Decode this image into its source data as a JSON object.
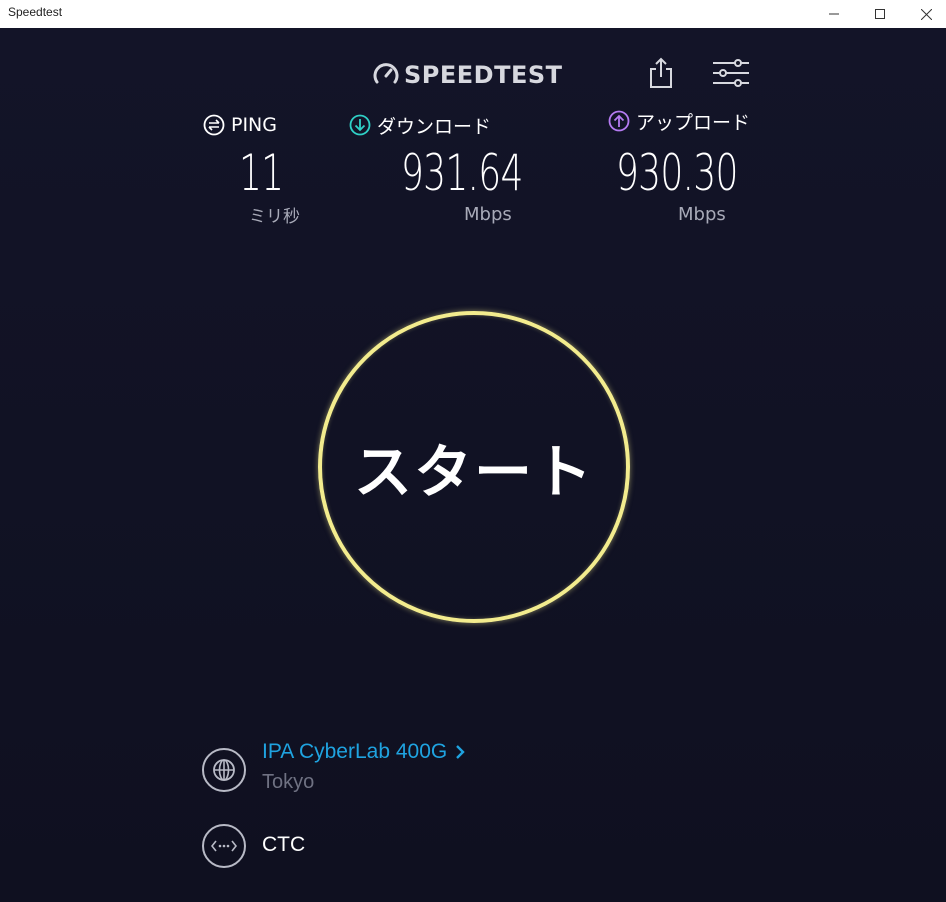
{
  "window": {
    "title": "Speedtest"
  },
  "header": {
    "logo_text": "SPEEDTEST",
    "share_icon": "share-icon",
    "settings_icon": "settings-sliders-icon"
  },
  "metrics": {
    "ping": {
      "label": "PING",
      "value": "11",
      "unit": "ミリ秒"
    },
    "download": {
      "label": "ダウンロード",
      "value": "931.64",
      "unit": "Mbps"
    },
    "upload": {
      "label": "アップロード",
      "value": "930.30",
      "unit": "Mbps"
    }
  },
  "start": {
    "label": "スタート"
  },
  "server": {
    "name": "IPA CyberLab 400G",
    "city": "Tokyo"
  },
  "isp": {
    "name": "CTC"
  },
  "colors": {
    "background": "#131428",
    "start_ring": "#f3ec8e",
    "download_accent": "#2fd0c6",
    "upload_accent": "#b57bf2",
    "server_link": "#1fa3e0"
  }
}
